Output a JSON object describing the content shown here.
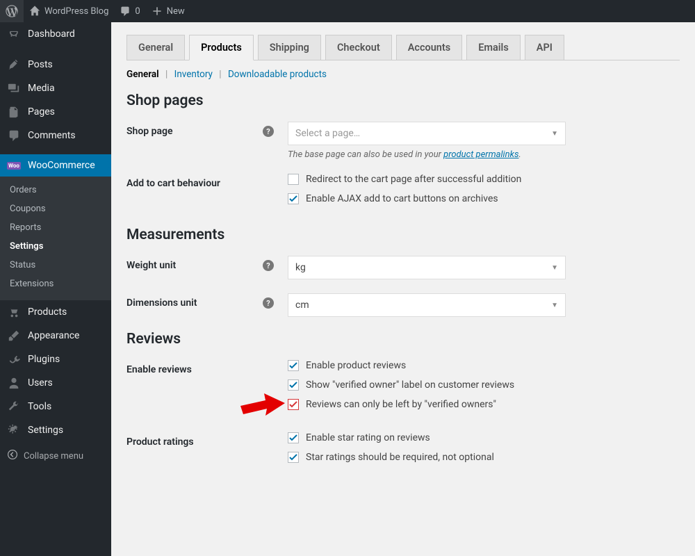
{
  "adminbar": {
    "site_title": "WordPress Blog",
    "comments_count": "0",
    "new_label": "New"
  },
  "sidebar": {
    "items": [
      {
        "label": "Dashboard",
        "icon": "dashboard"
      },
      {
        "label": "Posts",
        "icon": "pin"
      },
      {
        "label": "Media",
        "icon": "media"
      },
      {
        "label": "Pages",
        "icon": "pages"
      },
      {
        "label": "Comments",
        "icon": "comment"
      },
      {
        "label": "WooCommerce",
        "icon": "woo",
        "current": true,
        "submenu": [
          {
            "label": "Orders"
          },
          {
            "label": "Coupons"
          },
          {
            "label": "Reports"
          },
          {
            "label": "Settings",
            "current": true
          },
          {
            "label": "Status"
          },
          {
            "label": "Extensions"
          }
        ]
      },
      {
        "label": "Products",
        "icon": "products"
      },
      {
        "label": "Appearance",
        "icon": "brush"
      },
      {
        "label": "Plugins",
        "icon": "plug"
      },
      {
        "label": "Users",
        "icon": "user"
      },
      {
        "label": "Tools",
        "icon": "wrench"
      },
      {
        "label": "Settings",
        "icon": "cogs"
      }
    ],
    "collapse_label": "Collapse menu"
  },
  "tabs": {
    "items": [
      {
        "label": "General"
      },
      {
        "label": "Products",
        "active": true
      },
      {
        "label": "Shipping"
      },
      {
        "label": "Checkout"
      },
      {
        "label": "Accounts"
      },
      {
        "label": "Emails"
      },
      {
        "label": "API"
      }
    ]
  },
  "subtabs": {
    "items": [
      {
        "label": "General",
        "current": true
      },
      {
        "label": "Inventory"
      },
      {
        "label": "Downloadable products"
      }
    ]
  },
  "sections": {
    "shop_pages": {
      "heading": "Shop pages",
      "shop_page_label": "Shop page",
      "shop_page_placeholder": "Select a page…",
      "hint_prefix": "The base page can also be used in your ",
      "hint_link": "product permalinks",
      "hint_suffix": ".",
      "add_to_cart_label": "Add to cart behaviour",
      "redirect_label": "Redirect to the cart page after successful addition",
      "ajax_label": "Enable AJAX add to cart buttons on archives"
    },
    "measurements": {
      "heading": "Measurements",
      "weight_label": "Weight unit",
      "weight_value": "kg",
      "dim_label": "Dimensions unit",
      "dim_value": "cm"
    },
    "reviews": {
      "heading": "Reviews",
      "enable_label": "Enable reviews",
      "opt_enable": "Enable product reviews",
      "opt_verified": "Show \"verified owner\" label on customer reviews",
      "opt_only_owners": "Reviews can only be left by \"verified owners\"",
      "ratings_label": "Product ratings",
      "opt_star": "Enable star rating on reviews",
      "opt_star_required": "Star ratings should be required, not optional"
    }
  }
}
